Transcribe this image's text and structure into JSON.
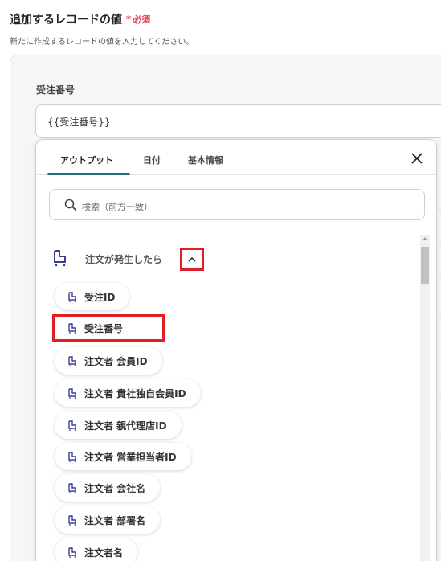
{
  "section": {
    "title": "追加するレコードの値",
    "required_star": "*",
    "required_text": "必須",
    "description": "新たに作成するレコードの値を入力してください。"
  },
  "field": {
    "label": "受注番号",
    "value": "{{受注番号}}"
  },
  "popup": {
    "tabs": [
      {
        "label": "アウトプット",
        "active": true
      },
      {
        "label": "日付",
        "active": false
      },
      {
        "label": "基本情報",
        "active": false
      }
    ],
    "search_placeholder": "検索（前方一致）",
    "trigger_label": "注文が発生したら",
    "items": [
      "受注ID",
      "受注番号",
      "注文者 会員ID",
      "注文者 貴社独自会員ID",
      "注文者 親代理店ID",
      "注文者 営業担当者ID",
      "注文者 会社名",
      "注文者 部署名",
      "注文者名"
    ]
  },
  "colors": {
    "required": "#e5435e",
    "accent": "#1f6f80",
    "highlight": "#e01e26",
    "icon": "#3b3f8f"
  }
}
